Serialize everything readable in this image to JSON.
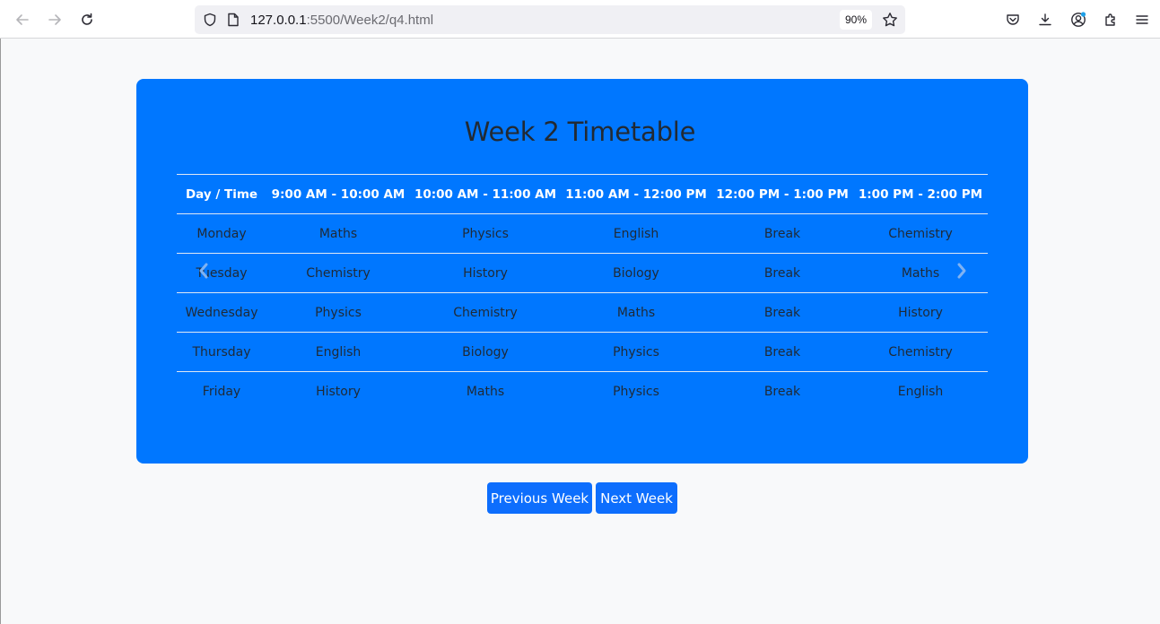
{
  "browser": {
    "url_host": "127.0.0.1",
    "url_path": ":5500/Week2/q4.html",
    "zoom": "90%"
  },
  "page": {
    "title": "Week 2 Timetable",
    "headers": [
      "Day / Time",
      "9:00 AM - 10:00 AM",
      "10:00 AM - 11:00 AM",
      "11:00 AM - 12:00 PM",
      "12:00 PM - 1:00 PM",
      "1:00 PM - 2:00 PM"
    ],
    "rows": [
      [
        "Monday",
        "Maths",
        "Physics",
        "English",
        "Break",
        "Chemistry"
      ],
      [
        "Tuesday",
        "Chemistry",
        "History",
        "Biology",
        "Break",
        "Maths"
      ],
      [
        "Wednesday",
        "Physics",
        "Chemistry",
        "Maths",
        "Break",
        "History"
      ],
      [
        "Thursday",
        "English",
        "Biology",
        "Physics",
        "Break",
        "Chemistry"
      ],
      [
        "Friday",
        "History",
        "Maths",
        "Physics",
        "Break",
        "English"
      ]
    ],
    "prev_label": "Previous Week",
    "next_label": "Next Week"
  },
  "colors": {
    "card": "#0077ff",
    "button": "#0d6efd",
    "page_bg": "#f8f9fa"
  },
  "icons": [
    "back-arrow-icon",
    "forward-arrow-icon",
    "reload-icon",
    "shield-icon",
    "page-icon",
    "bookmark-star-icon",
    "pocket-icon",
    "download-icon",
    "account-icon",
    "extensions-icon",
    "menu-icon",
    "carousel-prev-icon",
    "carousel-next-icon"
  ]
}
